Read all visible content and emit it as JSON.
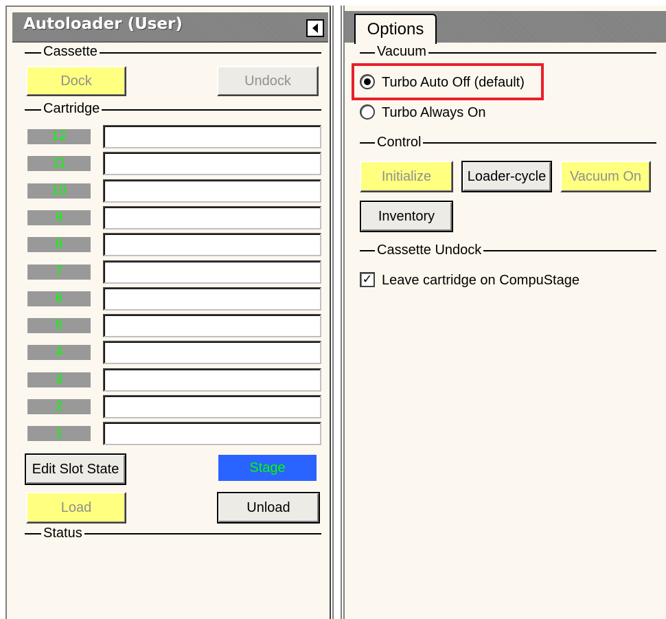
{
  "left_panel": {
    "title": "Autoloader (User)",
    "cassette": {
      "label": "Cassette",
      "dock_label": "Dock",
      "undock_label": "Undock"
    },
    "cartridge": {
      "label": "Cartridge",
      "slots": [
        "12",
        "11",
        "10",
        "9",
        "8",
        "7",
        "6",
        "5",
        "4",
        "3",
        "2",
        "1"
      ]
    },
    "edit_slot_state_label": "Edit Slot State",
    "stage_label": "Stage",
    "load_label": "Load",
    "unload_label": "Unload",
    "status": {
      "label": "Status"
    }
  },
  "right_panel": {
    "tabs": [
      {
        "label": "Options",
        "active": true
      }
    ],
    "vacuum": {
      "label": "Vacuum",
      "options": [
        {
          "label": "Turbo Auto Off (default)",
          "selected": true
        },
        {
          "label": "Turbo Always On",
          "selected": false
        }
      ]
    },
    "control": {
      "label": "Control",
      "initialize_label": "Initialize",
      "loader_cycle_label": "Loader-cycle",
      "vacuum_on_label": "Vacuum On",
      "inventory_label": "Inventory"
    },
    "cassette_undock": {
      "label": "Cassette Undock",
      "leave_cartridge_label": "Leave cartridge on CompuStage",
      "leave_cartridge_checked": true
    }
  },
  "colors": {
    "panel_bg": "#fdf8ef",
    "title_bar": "#808080",
    "yellow_button": "#ffff80",
    "slot_number_bg": "#999999",
    "slot_number_text": "#00ff00",
    "stage_bg": "#2a63ff",
    "highlight": "#e8202a"
  },
  "icons": {
    "collapse": "triangle-left-icon",
    "radio_selected": "radio-selected-icon",
    "radio_unselected": "radio-unselected-icon",
    "checkbox_checked": "checkbox-checked-icon"
  }
}
